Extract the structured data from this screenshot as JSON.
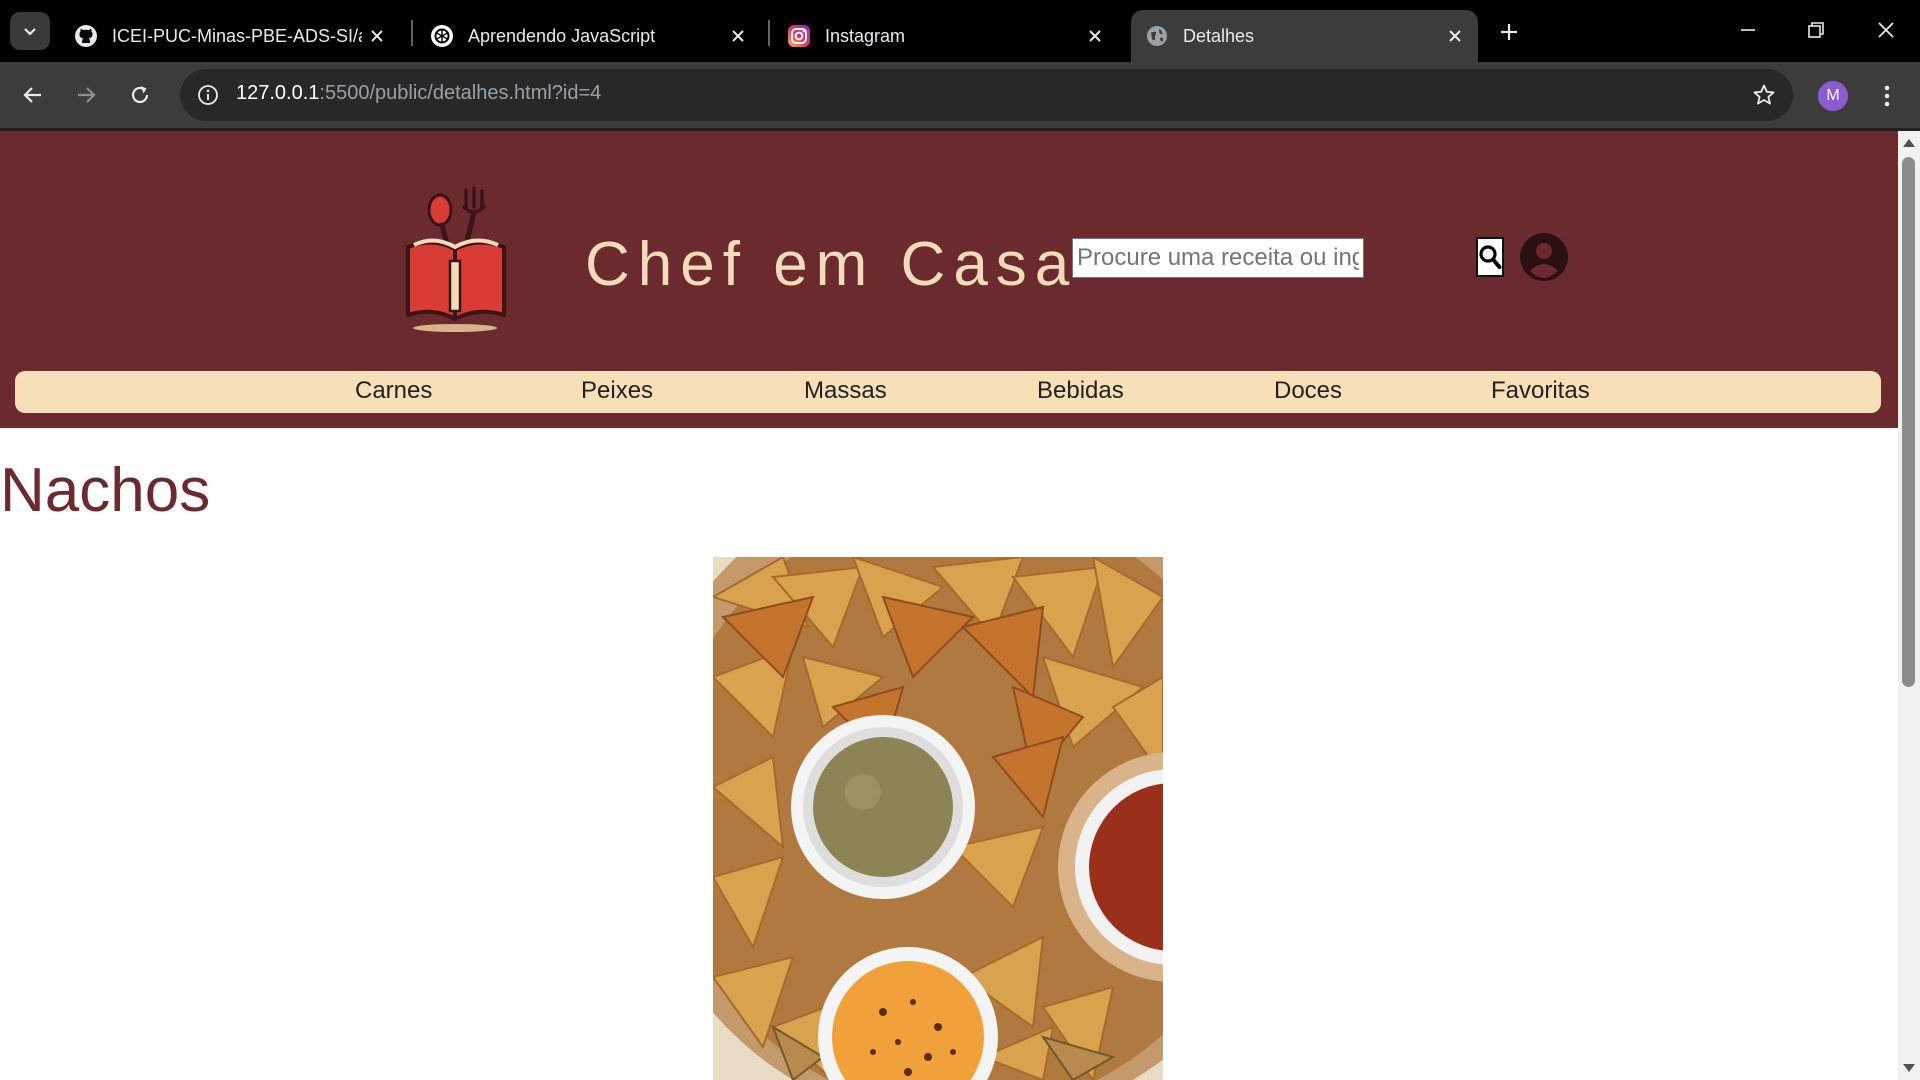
{
  "browser": {
    "tabs": [
      {
        "title": "ICEI-PUC-Minas-PBE-ADS-SI/at",
        "icon": "github-icon",
        "active": false
      },
      {
        "title": "Aprendendo JavaScript",
        "icon": "openai-icon",
        "active": false
      },
      {
        "title": "Instagram",
        "icon": "instagram-icon",
        "active": false
      },
      {
        "title": "Detalhes",
        "icon": "globe-icon",
        "active": true
      }
    ],
    "url_host": "127.0.0.1",
    "url_rest": ":5500/public/detalhes.html?id=4",
    "profile_initial": "M"
  },
  "site": {
    "title": "Chef em Casa",
    "search_placeholder": "Procure uma receita ou ingrediente",
    "nav": [
      "Carnes",
      "Peixes",
      "Massas",
      "Bebidas",
      "Doces",
      "Favoritas"
    ],
    "colors": {
      "header": "#6b2a2d",
      "nav": "#f7dfb8",
      "title_text": "#f3dcb7"
    }
  },
  "recipe": {
    "name": "Nachos",
    "image_alt": "nachos-photo"
  }
}
